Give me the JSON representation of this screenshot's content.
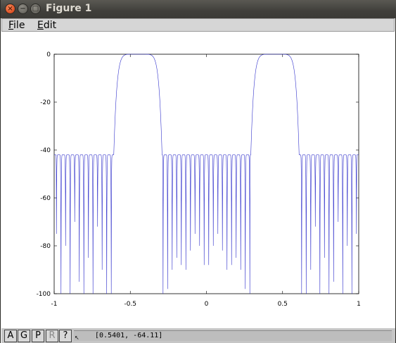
{
  "window": {
    "title": "Figure 1",
    "controls": {
      "close": "×",
      "minimize": "−",
      "maximize": "□"
    }
  },
  "menu": {
    "file": {
      "underline": "F",
      "rest": "ile"
    },
    "edit": {
      "underline": "E",
      "rest": "dit"
    }
  },
  "toolbar": {
    "buttons": [
      {
        "label": "A",
        "enabled": true
      },
      {
        "label": "G",
        "enabled": true
      },
      {
        "label": "P",
        "enabled": true
      },
      {
        "label": "R",
        "enabled": false
      },
      {
        "label": "?",
        "enabled": true
      }
    ],
    "cursor_symbol": "↖",
    "coordinates": "[0.5401, -64.11]"
  },
  "chart_data": {
    "type": "line",
    "title": "",
    "xlabel": "",
    "ylabel": "",
    "xlim": [
      -1,
      1
    ],
    "ylim": [
      -100,
      0
    ],
    "xticks": [
      -1,
      -0.5,
      0,
      0.5,
      1
    ],
    "xtick_labels": [
      "-1",
      "-0.5",
      "0",
      "0.5",
      "1"
    ],
    "yticks": [
      0,
      -20,
      -40,
      -60,
      -80,
      -100
    ],
    "ytick_labels": [
      "0",
      "-20",
      "-40",
      "-60",
      "-80",
      "-100"
    ],
    "grid": false,
    "line_color": "#3333cc",
    "series": [
      {
        "description_of_shape": "",
        "passbands": [
          [
            -0.55,
            -0.35
          ],
          [
            0.35,
            0.55
          ]
        ],
        "passband_level": 0,
        "stopband_ripple_peak": -42,
        "stopband_edges": [
          [
            -1,
            -0.6
          ],
          [
            -0.3,
            0.3
          ],
          [
            0.6,
            1
          ]
        ],
        "stopband_nulls_x": [
          -0.985,
          -0.955,
          -0.925,
          -0.895,
          -0.865,
          -0.835,
          -0.805,
          -0.775,
          -0.745,
          -0.715,
          -0.685,
          -0.655,
          -0.625,
          -0.285,
          -0.255,
          -0.225,
          -0.195,
          -0.165,
          -0.135,
          -0.105,
          -0.075,
          -0.045,
          -0.015,
          0.015,
          0.045,
          0.075,
          0.105,
          0.135,
          0.165,
          0.195,
          0.225,
          0.255,
          0.285,
          0.625,
          0.655,
          0.685,
          0.715,
          0.745,
          0.775,
          0.805,
          0.835,
          0.865,
          0.895,
          0.925,
          0.955,
          0.985
        ],
        "stopband_nulls_y": [
          -75,
          -100,
          -80,
          -100,
          -70,
          -95,
          -100,
          -85,
          -100,
          -72,
          -90,
          -100,
          -100,
          -100,
          -98,
          -90,
          -85,
          -88,
          -90,
          -82,
          -75,
          -80,
          -88,
          -88,
          -80,
          -75,
          -82,
          -90,
          -88,
          -85,
          -90,
          -98,
          -100,
          -100,
          -100,
          -90,
          -72,
          -100,
          -85,
          -100,
          -95,
          -70,
          -100,
          -80,
          -100,
          -75
        ]
      }
    ]
  }
}
